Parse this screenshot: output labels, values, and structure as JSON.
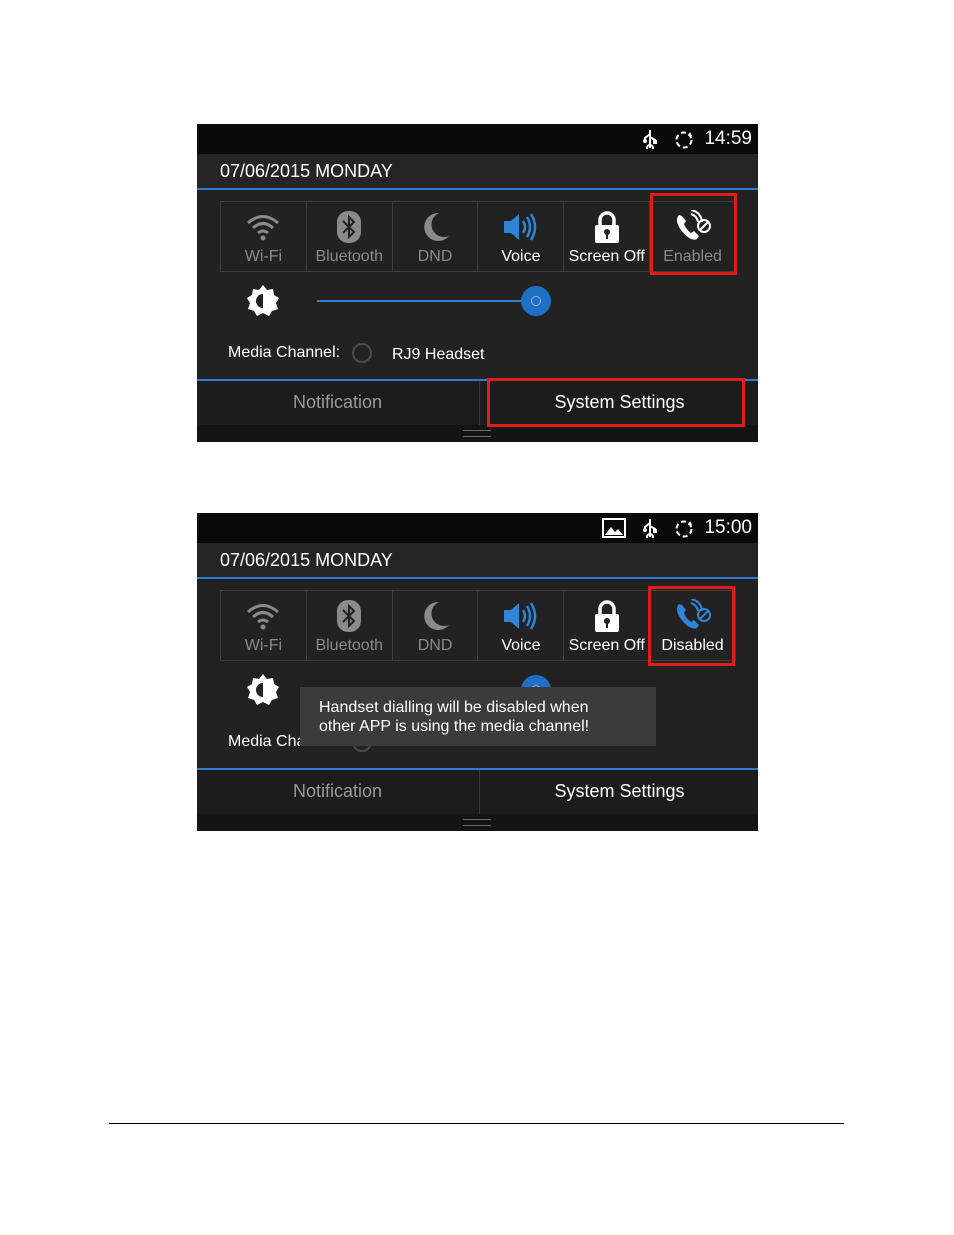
{
  "screenshots": [
    {
      "status": {
        "time": "14:59"
      },
      "date": "07/06/2015 MONDAY",
      "tiles": [
        {
          "label": "Wi-Fi",
          "icon": "wifi-icon",
          "active": false
        },
        {
          "label": "Bluetooth",
          "icon": "bluetooth-icon",
          "active": false
        },
        {
          "label": "DND",
          "icon": "moon-icon",
          "active": false
        },
        {
          "label": "Voice",
          "icon": "speaker-icon",
          "active": true
        },
        {
          "label": "Screen Off",
          "icon": "lock-icon",
          "active": true
        },
        {
          "label": "Enabled",
          "icon": "handset-dialling-icon",
          "active": false
        }
      ],
      "brightness_level": 1.0,
      "media_channel": {
        "label": "Media Channel:",
        "option": "RJ9 Headset",
        "selected": false
      },
      "tabs": {
        "left": "Notification",
        "right": "System Settings",
        "active": "right"
      }
    },
    {
      "status": {
        "time": "15:00"
      },
      "date": "07/06/2015 MONDAY",
      "tiles": [
        {
          "label": "Wi-Fi",
          "icon": "wifi-icon",
          "active": false
        },
        {
          "label": "Bluetooth",
          "icon": "bluetooth-icon",
          "active": false
        },
        {
          "label": "DND",
          "icon": "moon-icon",
          "active": false
        },
        {
          "label": "Voice",
          "icon": "speaker-icon",
          "active": true
        },
        {
          "label": "Screen Off",
          "icon": "lock-icon",
          "active": true
        },
        {
          "label": "Disabled",
          "icon": "handset-dialling-icon",
          "active": true
        }
      ],
      "media_channel": {
        "label": "Media Channel:"
      },
      "toast": {
        "line1": "Handset dialling will be disabled when",
        "line2": "other APP is using the media channel!"
      },
      "tabs": {
        "left": "Notification",
        "right": "System Settings",
        "active": "right"
      }
    }
  ],
  "colors": {
    "accent": "#2e7bcf",
    "highlight": "#e11a1a",
    "background": "#222222"
  }
}
